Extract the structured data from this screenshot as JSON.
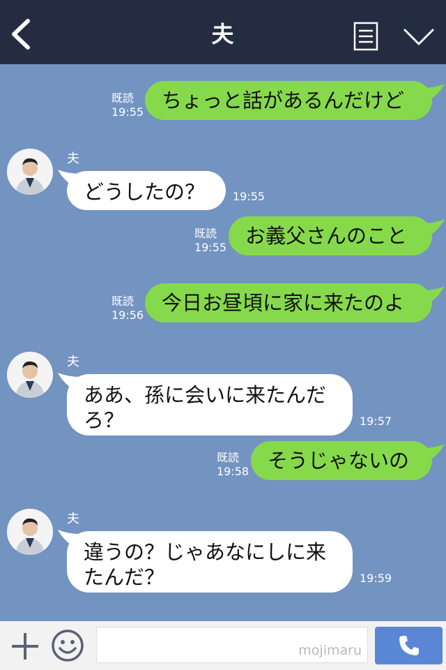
{
  "header": {
    "title": "夫"
  },
  "messages": [
    {
      "side": "out",
      "text": "ちょっと話があるんだけど",
      "read": "既読",
      "time": "19:55"
    },
    {
      "side": "in",
      "sender": "夫",
      "text": "どうしたの？",
      "time": "19:55"
    },
    {
      "side": "out",
      "text": "お義父さんのこと",
      "read": "既読",
      "time": "19:55"
    },
    {
      "side": "out",
      "text": "今日お昼頃に家に来たのよ",
      "read": "既読",
      "time": "19:56"
    },
    {
      "side": "in",
      "sender": "夫",
      "text_line1": "ああ、孫に会いに来たんだ",
      "text_line2": "ろ？",
      "time": "19:57"
    },
    {
      "side": "out",
      "text": "そうじゃないの",
      "read": "既読",
      "time": "19:58"
    },
    {
      "side": "in",
      "sender": "夫",
      "text_line1": "違うの？じゃあなにしに来",
      "text_line2": "たんだ？",
      "time": "19:59"
    }
  ],
  "input": {
    "watermark": "mojimaru"
  },
  "icons": {
    "back": "chevron-left-icon",
    "menu": "list-icon",
    "down": "chevron-down-icon",
    "plus": "plus-icon",
    "emoji": "smiley-icon",
    "call": "phone-icon"
  },
  "colors": {
    "header_bg": "#242c42",
    "chat_bg": "#7393c1",
    "outgoing_bubble": "#86d94b",
    "incoming_bubble": "#ffffff",
    "call_button": "#5a86d6"
  }
}
